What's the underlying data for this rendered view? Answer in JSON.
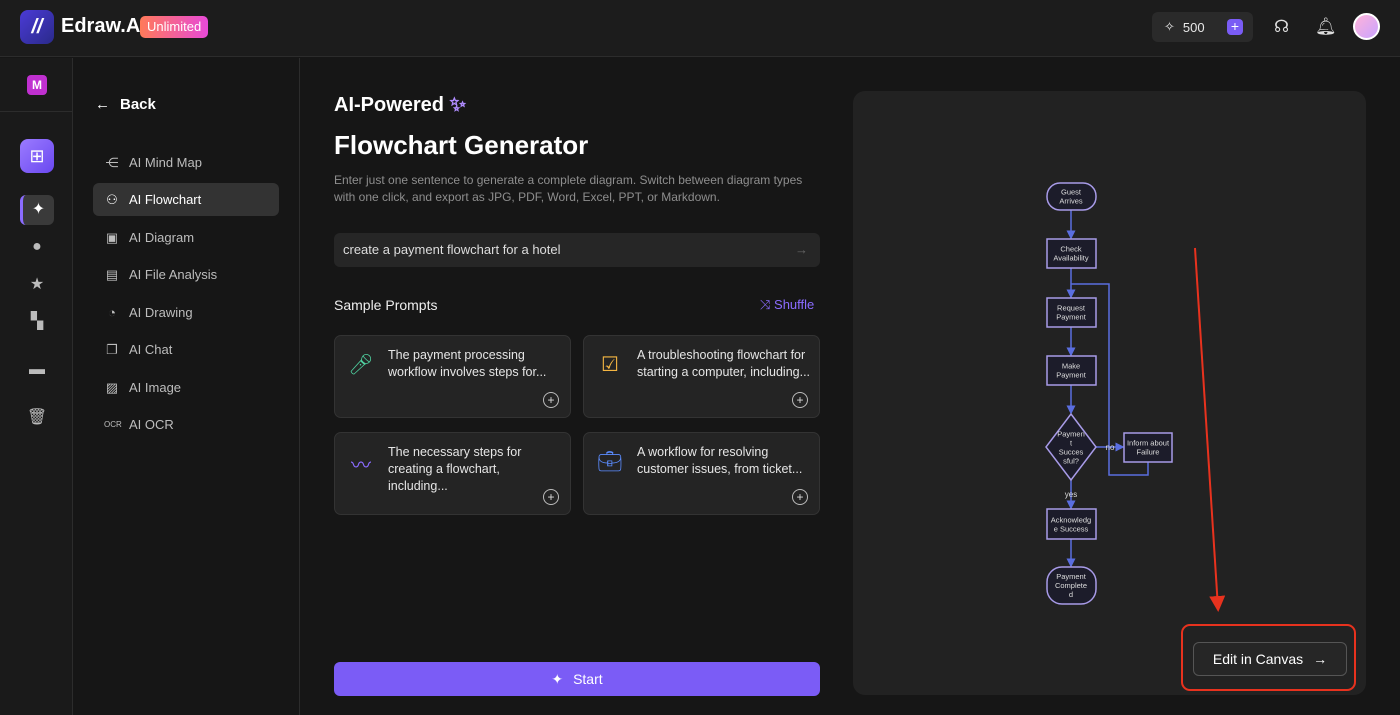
{
  "header": {
    "brand": "Edraw.AI",
    "plan_badge": "Unlimited",
    "credits": "500"
  },
  "rail": {
    "workspace_initial": "M"
  },
  "nav": {
    "back_label": "Back",
    "items": [
      {
        "label": "AI Mind Map",
        "icon": "mindmap-icon"
      },
      {
        "label": "AI Flowchart",
        "icon": "flowchart-icon",
        "active": true
      },
      {
        "label": "AI Diagram",
        "icon": "diagram-icon"
      },
      {
        "label": "AI File Analysis",
        "icon": "file-analysis-icon"
      },
      {
        "label": "AI Drawing",
        "icon": "palette-icon"
      },
      {
        "label": "AI Chat",
        "icon": "chat-icon"
      },
      {
        "label": "AI Image",
        "icon": "image-icon"
      },
      {
        "label": "AI OCR",
        "icon": "ocr-icon"
      }
    ]
  },
  "main": {
    "kicker": "AI-Powered",
    "title": "Flowchart Generator",
    "description": "Enter just one sentence to generate a complete diagram. Switch between diagram types with one click, and export as JPG, PDF, Word, Excel, PPT, or Markdown.",
    "prompt_value": "create a payment flowchart for a hotel",
    "sample_prompts_label": "Sample Prompts",
    "shuffle_label": "Shuffle",
    "samples": [
      {
        "text": "The payment processing workflow involves steps for...",
        "icon": "microphone-icon"
      },
      {
        "text": "A troubleshooting flowchart for starting a computer, including...",
        "icon": "checklist-icon"
      },
      {
        "text": "The necessary steps for creating a flowchart, including...",
        "icon": "waveform-icon"
      },
      {
        "text": "A workflow for resolving customer issues, from ticket...",
        "icon": "toolbox-icon"
      }
    ],
    "start_label": "Start"
  },
  "preview": {
    "edit_label": "Edit in Canvas",
    "flowchart": {
      "nodes": [
        "Guest|Arrives",
        "Check|Availability",
        "Request|Payment",
        "Make|Payment",
        "Paymen|t|Succes|sful?",
        "Inform about|Failure",
        "Acknowledg|e Success",
        "Payment|Complete|d"
      ],
      "edge_no": "no",
      "edge_yes": "yes"
    }
  },
  "colors": {
    "accent": "#7b5cf6",
    "annotation": "#e8321e",
    "flow_line": "#5a6ee0",
    "flow_node_border": "#a89be8"
  }
}
